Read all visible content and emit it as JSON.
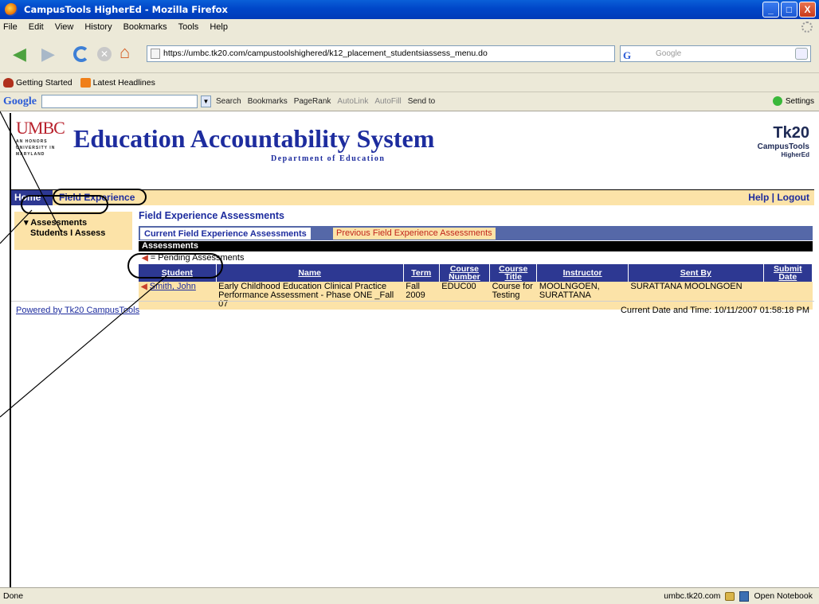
{
  "window": {
    "title": "CampusTools HigherEd - Mozilla Firefox",
    "buttons": [
      "_",
      "□",
      "X"
    ]
  },
  "menu": [
    "File",
    "Edit",
    "View",
    "History",
    "Bookmarks",
    "Tools",
    "Help"
  ],
  "nav": {
    "url": "https://umbc.tk20.com/campustoolshighered/k12_placement_studentsiassess_menu.do",
    "search_placeholder": "Google"
  },
  "bookmarks": [
    "Getting Started",
    "Latest Headlines"
  ],
  "googlebar": {
    "logo": "Google",
    "items": [
      "Search",
      "Bookmarks",
      "PageRank",
      "AutoLink",
      "AutoFill",
      "Send to"
    ],
    "settings": "Settings"
  },
  "banner": {
    "umbc": "UMBC",
    "umbc_sub": "AN HONORS UNIVERSITY IN MARYLAND",
    "title": "Education Accountability System",
    "dept": "Department of Education",
    "tk20": "Tk20",
    "tk20_line1": "CampusTools",
    "tk20_line2": "HigherEd"
  },
  "topnav": {
    "home": "Home",
    "field_experience": "Field Experience",
    "help": "Help",
    "sep": "|",
    "logout": "Logout"
  },
  "sidebar": {
    "assessments": "Assessments",
    "students_i_assess": "Students I Assess"
  },
  "main": {
    "heading": "Field Experience Assessments",
    "tab_current": "Current Field Experience Assessments",
    "tab_previous": "Previous Field Experience Assessments",
    "section": "Assessments",
    "legend": "= Pending Assessments",
    "columns": [
      "Student",
      "Name",
      "Term",
      "Course Number",
      "Course Title",
      "Instructor",
      "Sent By",
      "Submit Date"
    ],
    "rows": [
      {
        "student": "Smith, John",
        "name": "Early Childhood Education Clinical Practice Performance Assessment - Phase ONE _Fall 07",
        "term": "Fall 2009",
        "course_number": "EDUC00",
        "course_title": "Course for Testing",
        "instructor": "MOOLNGOEN, SURATTANA",
        "sent_by": "SURATTANA MOOLNGOEN",
        "submit_date": ""
      }
    ]
  },
  "footer": {
    "powered": "Powered by Tk20 CampusTools",
    "datetime": "Current Date and Time: 10/11/2007 01:58:18 PM"
  },
  "status": {
    "left": "Done",
    "domain": "umbc.tk20.com",
    "notebook": "Open Notebook"
  }
}
